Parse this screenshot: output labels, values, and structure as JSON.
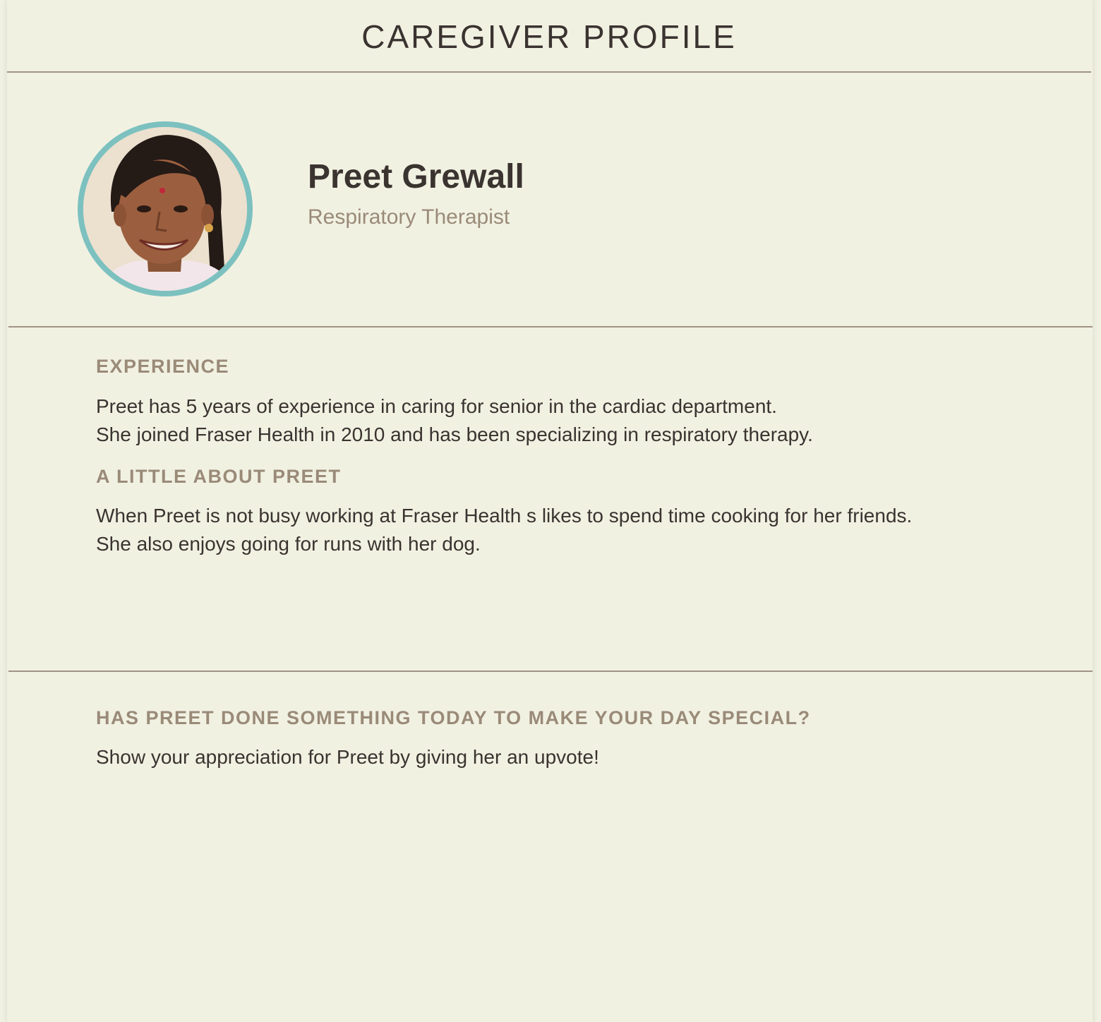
{
  "header": {
    "title": "CAREGIVER PROFILE"
  },
  "profile": {
    "name": "Preet Grewall",
    "role": "Respiratory Therapist",
    "avatar_icon": "caregiver-photo",
    "accent_color": "#7cc1bf"
  },
  "experience": {
    "label": "EXPERIENCE",
    "line1": "Preet has 5 years of experience in caring for senior in the cardiac department.",
    "line2": "She joined Fraser Health in 2010 and has been specializing in respiratory therapy."
  },
  "about": {
    "label": "A LITTLE ABOUT PREET",
    "line1": "When Preet is not busy working at Fraser Health s likes to spend time cooking for her friends.",
    "line2": "She also enjoys going for runs with her dog."
  },
  "appreciation": {
    "label": "HAS PREET DONE SOMETHING TODAY TO MAKE YOUR DAY SPECIAL?",
    "text": "Show your appreciation for Preet by giving her an upvote!"
  }
}
